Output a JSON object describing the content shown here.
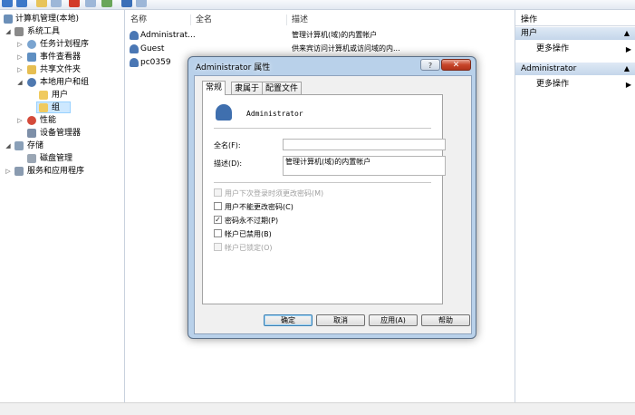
{
  "tree": {
    "items": [
      {
        "label": "计算机管理(本地)",
        "expander": ""
      },
      {
        "label": "系统工具",
        "expander": "◢"
      },
      {
        "label": "任务计划程序",
        "expander": "▷"
      },
      {
        "label": "事件查看器",
        "expander": "▷"
      },
      {
        "label": "共享文件夹",
        "expander": "▷"
      },
      {
        "label": "本地用户和组",
        "expander": "◢"
      },
      {
        "label": "用户",
        "expander": ""
      },
      {
        "label": "组",
        "expander": ""
      },
      {
        "label": "性能",
        "expander": "▷"
      },
      {
        "label": "设备管理器",
        "expander": ""
      },
      {
        "label": "存储",
        "expander": "◢"
      },
      {
        "label": "磁盘管理",
        "expander": ""
      },
      {
        "label": "服务和应用程序",
        "expander": "▷"
      }
    ]
  },
  "list": {
    "columns": [
      "名称",
      "全名",
      "描述"
    ],
    "rows": [
      {
        "name": "Administrat...",
        "fullname": "",
        "desc": "管理计算机(域)的内置帐户"
      },
      {
        "name": "Guest",
        "fullname": "",
        "desc": "供来宾访问计算机或访问域的内..."
      },
      {
        "name": "pc0359",
        "fullname": "",
        "desc": ""
      }
    ]
  },
  "actions": {
    "title": "操作",
    "sections": [
      {
        "header": "用户",
        "item": "更多操作"
      },
      {
        "header": "Administrator",
        "item": "更多操作"
      }
    ],
    "collapse_glyph": "▲",
    "more_glyph": "▶"
  },
  "dialog": {
    "title": "Administrator 属性",
    "help_glyph": "?",
    "close_glyph": "✕",
    "tabs": [
      "常规",
      "隶属于",
      "配置文件"
    ],
    "username": "Administrator",
    "fullname_label": "全名(F):",
    "fullname_value": "",
    "desc_label": "描述(D):",
    "desc_value": "管理计算机(域)的内置帐户",
    "checks": [
      {
        "label": "用户下次登录时须更改密码(M)",
        "checked": false,
        "disabled": true,
        "mark": ""
      },
      {
        "label": "用户不能更改密码(C)",
        "checked": false,
        "disabled": false,
        "mark": ""
      },
      {
        "label": "密码永不过期(P)",
        "checked": true,
        "disabled": false,
        "mark": "✓"
      },
      {
        "label": "帐户已禁用(B)",
        "checked": false,
        "disabled": false,
        "mark": ""
      },
      {
        "label": "帐户已锁定(O)",
        "checked": false,
        "disabled": true,
        "mark": ""
      }
    ],
    "buttons": {
      "ok": "确定",
      "cancel": "取消",
      "apply": "应用(A)",
      "help": "帮助"
    }
  },
  "colors": {
    "accent": "#c4d6ea",
    "selection": "#cde8ff",
    "dialog_frame": "#b9d1ea"
  }
}
